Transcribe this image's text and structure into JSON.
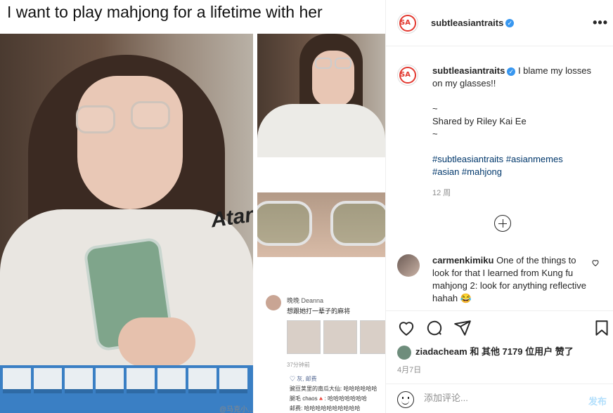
{
  "meme": {
    "title": "I want to play mahjong for a lifetime with her",
    "main_logo_text": "Atan",
    "chat": {
      "name": "晚晚 Deanna",
      "message": "想跟她打一辈子的麻将",
      "time": "37分钟前",
      "likes": "♡ 灰, 邮费",
      "lines": [
        "豌豆荚里的南瓜大仙: 哈哈哈哈哈哈",
        "腿毛 chaos🔺: 哈哈哈哈哈哈哈",
        "邮费: 哈哈哈哈哈哈哈哈哈哈"
      ]
    },
    "watermark": "@马克小..."
  },
  "post": {
    "header_username": "subtleasiantraits",
    "verified_mark": "✓",
    "more_label": "•••",
    "avatar_text": "SA",
    "caption": {
      "username": "subtleasiantraits",
      "text": "I blame my losses on my glasses!!",
      "tilde1": "~",
      "shared": "Shared by Riley Kai Ee",
      "tilde2": "~",
      "tags_line1": "#subtleasiantraits #asianmemes",
      "tags_line2": "#asian #mahjong"
    },
    "ago": "12 周",
    "comment": {
      "username": "carmenkimiku",
      "text": "One of the things to look for that I learned from Kung fu mahjong 2: look for anything reflective hahah 😂"
    },
    "likes": {
      "username": "ziadacheam",
      "text": "和 其他 7179 位用户 赞了"
    },
    "date": "4月7日",
    "comment_placeholder": "添加评论...",
    "post_label": "发布"
  }
}
